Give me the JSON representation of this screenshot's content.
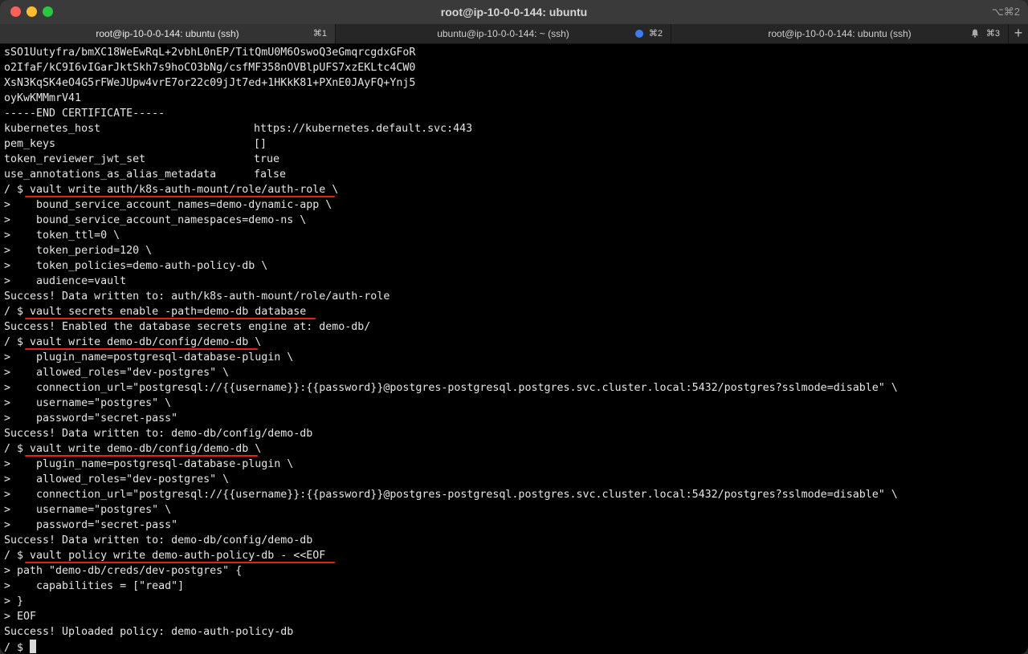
{
  "window": {
    "title": "root@ip-10-0-0-144: ubuntu",
    "shortcut": "⌥⌘2"
  },
  "tabs": [
    {
      "label": "root@ip-10-0-0-144: ubuntu (ssh)",
      "key": "⌘1",
      "active": true
    },
    {
      "label": "ubuntu@ip-10-0-0-144: ~ (ssh)",
      "key": "⌘2",
      "indicator": "blue-dot-icon"
    },
    {
      "label": "root@ip-10-0-0-144: ubuntu (ssh)",
      "key": "⌘3",
      "indicator": "bell-icon"
    }
  ],
  "new_tab": "+",
  "accent_colors": {
    "underline": "#e8201a",
    "active_dot": "#3d7bf5"
  },
  "terminal": {
    "cert_lines": [
      "sSO1Uutyfra/bmXC18WeEwRqL+2vbhL0nEP/TitQmU0M6OswoQ3eGmqrcgdxGFoR",
      "o2IfaF/kC9I6vIGarJktSkh7s9hoCO3bNg/csfMF358nOVBlpUFS7xzEKLtc4CW0",
      "XsN3KqSK4eO4G5rFWeJUpw4vrE7or22c09jJt7ed+1HKkK81+PXnE0JAyFQ+Ynj5",
      "oyKwKMMmrV41",
      "-----END CERTIFICATE-----"
    ],
    "config": [
      {
        "key": "kubernetes_host",
        "value": "https://kubernetes.default.svc:443"
      },
      {
        "key": "pem_keys",
        "value": "[]"
      },
      {
        "key": "token_reviewer_jwt_set",
        "value": "true"
      },
      {
        "key": "use_annotations_as_alias_metadata",
        "value": "false"
      }
    ],
    "blocks": [
      {
        "prompt": "/ $ ",
        "command": "vault write auth/k8s-auth-mount/role/auth-role",
        "suffix": " \\",
        "continuation": [
          ">    bound_service_account_names=demo-dynamic-app \\",
          ">    bound_service_account_namespaces=demo-ns \\",
          ">    token_ttl=0 \\",
          ">    token_period=120 \\",
          ">    token_policies=demo-auth-policy-db \\",
          ">    audience=vault"
        ],
        "output": "Success! Data written to: auth/k8s-auth-mount/role/auth-role"
      },
      {
        "prompt": "/ $ ",
        "command": "vault secrets enable -path=demo-db database",
        "suffix": "",
        "continuation": [],
        "output": "Success! Enabled the database secrets engine at: demo-db/"
      },
      {
        "prompt": "/ $ ",
        "command": "vault write demo-db/config/demo-db",
        "suffix": " \\",
        "continuation": [
          ">    plugin_name=postgresql-database-plugin \\",
          ">    allowed_roles=\"dev-postgres\" \\",
          ">    connection_url=\"postgresql://{{username}}:{{password}}@postgres-postgresql.postgres.svc.cluster.local:5432/postgres?sslmode=disable\" \\",
          ">    username=\"postgres\" \\",
          ">    password=\"secret-pass\""
        ],
        "output": "Success! Data written to: demo-db/config/demo-db"
      },
      {
        "prompt": "/ $ ",
        "command": "vault write demo-db/config/demo-db",
        "suffix": " \\",
        "continuation": [
          ">    plugin_name=postgresql-database-plugin \\",
          ">    allowed_roles=\"dev-postgres\" \\",
          ">    connection_url=\"postgresql://{{username}}:{{password}}@postgres-postgresql.postgres.svc.cluster.local:5432/postgres?sslmode=disable\" \\",
          ">    username=\"postgres\" \\",
          ">    password=\"secret-pass\""
        ],
        "output": "Success! Data written to: demo-db/config/demo-db"
      },
      {
        "prompt": "/ $ ",
        "command": "vault policy write demo-auth-policy-db - <<EOF",
        "suffix": "",
        "continuation": [
          "> path \"demo-db/creds/dev-postgres\" {",
          ">    capabilities = [\"read\"]",
          "> }",
          "> EOF"
        ],
        "output": "Success! Uploaded policy: demo-auth-policy-db"
      }
    ],
    "final_prompt": "/ $ "
  }
}
